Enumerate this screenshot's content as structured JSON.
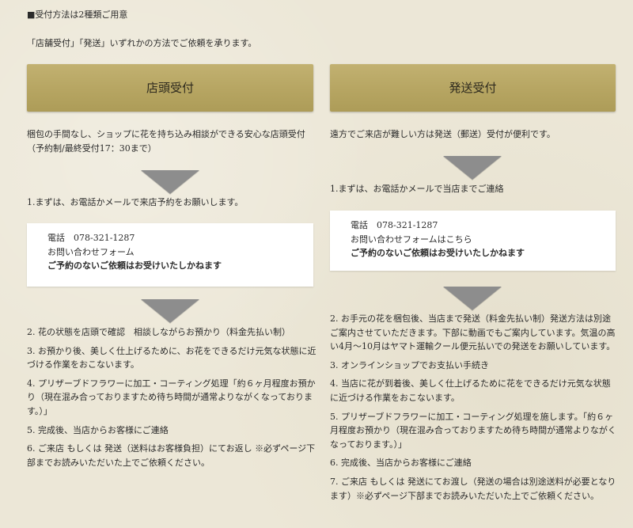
{
  "heading": "■受付方法は2種類ご用意",
  "intro": "「店舗受付」「発送」いずれかの方法でご依頼を承ります。",
  "left": {
    "banner": "店頭受付",
    "description": "梱包の手間なし、ショップに花を持ち込み相談ができる安心な店頭受付（予約制/最終受付17：30まで）",
    "step1": "1.まずは、お電話かメールで来店予約をお願いします。",
    "contact": {
      "phone": "電話　078-321-1287",
      "form": "お問い合わせフォーム",
      "note": "ご予約のないご依頼はお受けいたしかねます"
    },
    "steps": [
      "2. 花の状態を店頭で確認　相談しながらお預かり（料金先払い制）",
      "3. お預かり後、美しく仕上げるために、お花をできるだけ元気な状態に近づける作業をおこないます。",
      "4. プリザーブドフラワーに加工・コーティング処理「約６ヶ月程度お預かり（現在混み合っておりますため待ち時間が通常よりながくなっております。）」",
      "5. 完成後、当店からお客様にご連絡",
      "6. ご来店 もしくは 発送（送料はお客様負担）にてお返し ※必ずページ下部までお読みいただいた上でご依頼ください。"
    ]
  },
  "right": {
    "banner": "発送受付",
    "description": "遠方でご来店が難しい方は発送（郵送）受付が便利です。",
    "step1": "1.まずは、お電話かメールで当店までご連絡",
    "contact": {
      "phone": "電話　078-321-1287",
      "form": "お問い合わせフォームはこちら",
      "note": "ご予約のないご依頼はお受けいたしかねます"
    },
    "steps": [
      "2. お手元の花を梱包後、当店まで発送（料金先払い制）発送方法は別途ご案内させていただきます。下部に動画でもご案内しています。気温の高い4月〜10月はヤマト運輸クール便元払いでの発送をお願いしています。",
      "3. オンラインショップでお支払い手続き",
      "4. 当店に花が到着後、美しく仕上げるために花をできるだけ元気な状態に近づける作業をおこないます。",
      "5. プリザーブドフラワーに加工・コーティング処理を施します。「約６ヶ月程度お預かり（現在混み合っておりますため待ち時間が通常よりながくなっております。）」",
      "6. 完成後、当店からお客様にご連絡",
      "7. ご来店 もしくは 発送にてお渡し（発送の場合は別途送料が必要となります）※必ずページ下部までお読みいただいた上でご依頼ください。"
    ]
  }
}
